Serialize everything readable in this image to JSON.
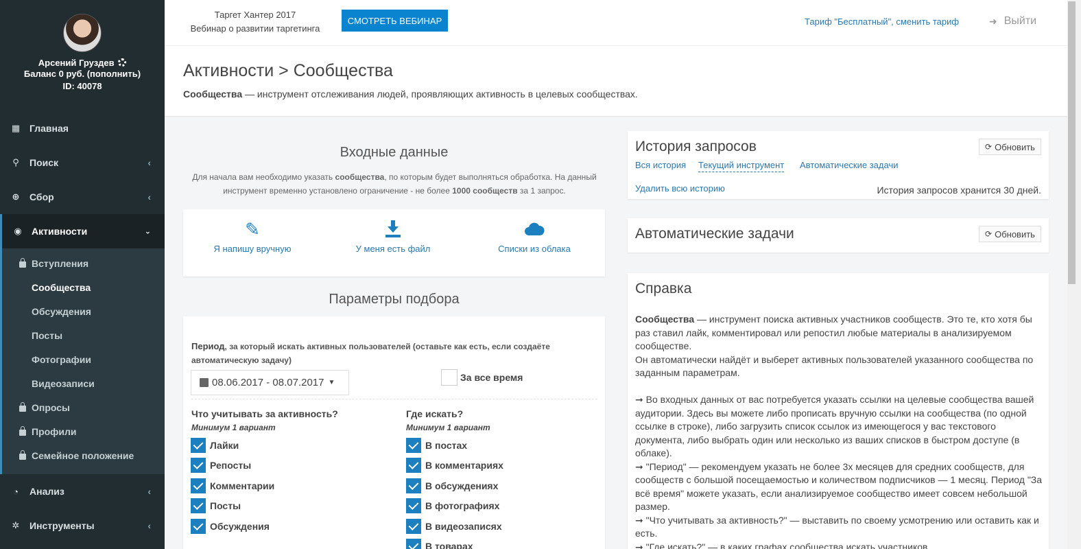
{
  "profile": {
    "name": "Арсений Груздев",
    "balance": "Баланс 0 руб. (пополнить)",
    "id": "ID: 40078"
  },
  "nav": {
    "home": "Главная",
    "search": "Поиск",
    "collect": "Сбор",
    "activity": "Активности",
    "analysis": "Анализ",
    "tools": "Инструменты"
  },
  "submenu": {
    "joins": "Вступления",
    "communities": "Сообщества",
    "discussions": "Обсуждения",
    "posts": "Посты",
    "photos": "Фотографии",
    "videos": "Видеозаписи",
    "polls": "Опросы",
    "profiles": "Профили",
    "family": "Семейное положение"
  },
  "topbar": {
    "promo_line1": "Таргет Хантер 2017",
    "promo_line2": "Вебинар о развитии таргетинга",
    "webinar_button": "СМОТРЕТЬ ВЕБИНАР",
    "tariff": "Тариф \"Бесплатный\", сменить тариф",
    "logout": "Выйти"
  },
  "header": {
    "title": "Активности > Сообщества",
    "desc_bold": "Сообщества",
    "desc_rest": " — инструмент отслеживания людей, проявляющих активность в целевых сообществах."
  },
  "input": {
    "title": "Входные данные",
    "intro_1": "Для начала вам необходимо указать ",
    "intro_bold1": "сообщества",
    "intro_2": ", по которым будет выполняться обработка. На данный инструмент временно установлено ограничение - не более ",
    "intro_bold2": "1000 сообществ",
    "intro_3": " за 1 запрос.",
    "manual": "Я напишу вручную",
    "file": "У меня есть файл",
    "cloud": "Списки из облака"
  },
  "params": {
    "title": "Параметры подбора",
    "period_bold": "Период",
    "period_rest": ", за который искать активных пользователей (оставьте как есть, если создаёте автоматическую задачу)",
    "date_range": "08.06.2017 - 08.07.2017",
    "all_time": "За все время",
    "what_head": "Что учитывать за активность?",
    "where_head": "Где искать?",
    "min_one": "Минимум 1 вариант",
    "what": [
      "Лайки",
      "Репосты",
      "Комментарии",
      "Посты",
      "Обсуждения"
    ],
    "where": [
      "В постах",
      "В комментариях",
      "В обсуждениях",
      "В фотографиях",
      "В видеозаписях",
      "В товарах"
    ]
  },
  "history": {
    "title": "История запросов",
    "refresh": "Обновить",
    "tab_all": "Вся история",
    "tab_current": "Текущий инструмент",
    "tab_auto": "Автоматические задачи",
    "delete": "Удалить всю историю",
    "kept": "История запросов хранится 30 дней."
  },
  "auto": {
    "title": "Автоматические задачи",
    "refresh": "Обновить"
  },
  "help": {
    "title": "Справка",
    "p1_bold": "Сообщества",
    "p1_rest": " — инструмент поиска активных участников сообществ. Это те, кто хотя бы раз ставил лайк, комментировал или репостил любые материалы в анализируемом сообществе.",
    "p2": "Он автоматически найдёт и выберет активных пользователей указанного сообщества по заданным параметрам.",
    "p3": "➞ Во входных данных от вас потребуется указать ссылки на целевые сообщества вашей аудитории. Здесь вы можете либо прописать вручную ссылки на сообщества (по одной ссылке в строке), либо загрузить список ссылок из имеющегося у вас текстового документа, либо выбрать один или несколько из ваших списков в быстром доступе (в облаке).",
    "p4": "➞ \"Период\" — рекомендуем указать не более 3х месяцев для средних сообществ, для сообществ с большой посещаемостью и количеством подписчиков — 1 месяц. Период \"За всё время\" можете указать, если анализируемое сообщество имеет совсем небольшой размер.",
    "p5": "➞ \"Что учитывать за активность?\" — выставить по своему усмотрению или оставить как и есть.",
    "p6": "➞ \"Где искать?\" — в каких графах сообщества искать участников."
  }
}
